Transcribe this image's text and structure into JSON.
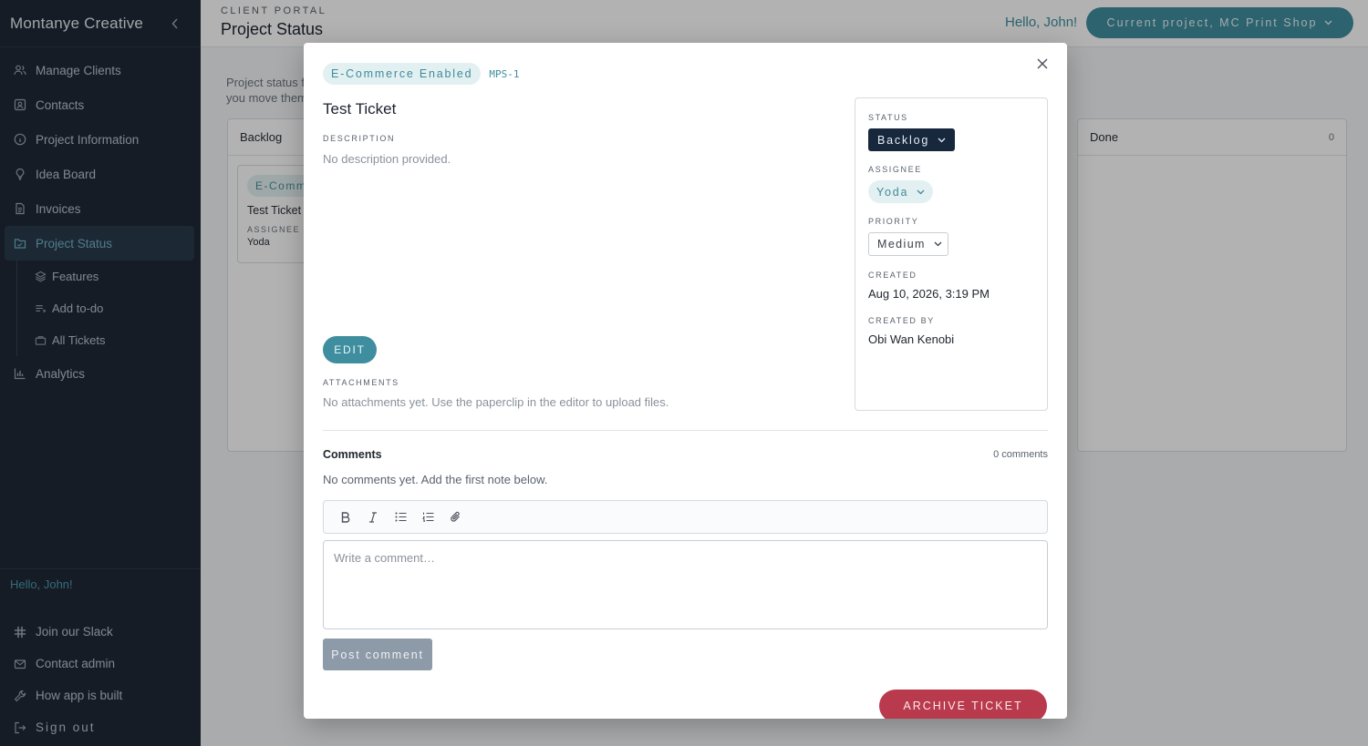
{
  "sidebar": {
    "brand": "Montanye Creative",
    "collapse_icon": "chevron-left-icon",
    "items": [
      {
        "label": "Manage Clients",
        "icon": "users-icon"
      },
      {
        "label": "Contacts",
        "icon": "contacts-icon"
      },
      {
        "label": "Project Information",
        "icon": "info-icon"
      },
      {
        "label": "Idea Board",
        "icon": "lightbulb-icon"
      },
      {
        "label": "Invoices",
        "icon": "document-icon"
      },
      {
        "label": "Project Status",
        "icon": "folder-icon",
        "active": true
      }
    ],
    "sub_items": [
      {
        "label": "Features",
        "icon": "layers-icon"
      },
      {
        "label": "Add to-do",
        "icon": "list-add-icon"
      },
      {
        "label": "All Tickets",
        "icon": "ticket-icon"
      }
    ],
    "analytics": {
      "label": "Analytics",
      "icon": "bar-chart-icon"
    },
    "greeting": "Hello, John!",
    "bottom_items": [
      {
        "label": "Join our Slack",
        "icon": "slack-icon"
      },
      {
        "label": "Contact admin",
        "icon": "mail-icon"
      },
      {
        "label": "How app is built",
        "icon": "wrench-icon"
      },
      {
        "label": "Sign out",
        "icon": "sign-out-icon"
      }
    ]
  },
  "header": {
    "kicker": "CLIENT PORTAL",
    "title": "Project Status",
    "greeting": "Hello, John!",
    "project_button": "Current project, MC Print Shop"
  },
  "board": {
    "intro_line1": "Project status f",
    "intro_line2": "you move them",
    "columns": [
      {
        "name": "Backlog",
        "count": ""
      },
      {
        "name": "Done",
        "count": "0"
      }
    ],
    "card": {
      "tag": "E-Comm",
      "title": "Test Ticket",
      "assignee_label": "ASSIGNEE",
      "assignee": "Yoda"
    }
  },
  "modal": {
    "tag": "E-Commerce Enabled",
    "ticket_id": "MPS-1",
    "title": "Test Ticket",
    "description_label": "DESCRIPTION",
    "description": "No description provided.",
    "edit_label": "EDIT",
    "attachments_label": "ATTACHMENTS",
    "attachments_text": "No attachments yet. Use the paperclip in the editor to upload files.",
    "meta": {
      "status_label": "STATUS",
      "status": "Backlog",
      "assignee_label": "ASSIGNEE",
      "assignee": "Yoda",
      "priority_label": "PRIORITY",
      "priority": "Medium",
      "created_label": "CREATED",
      "created": "Aug 10, 2026, 3:19 PM",
      "created_by_label": "CREATED BY",
      "created_by": "Obi Wan Kenobi"
    },
    "comments": {
      "title": "Comments",
      "count": "0 comments",
      "empty": "No comments yet. Add the first note below.",
      "placeholder": "Write a comment…",
      "post_label": "Post comment"
    },
    "archive_label": "ARCHIVE TICKET"
  },
  "colors": {
    "sidebar_bg": "#1f2937",
    "accent": "#3f8e9f",
    "status_bg": "#17283d",
    "danger": "#b83a4c"
  }
}
